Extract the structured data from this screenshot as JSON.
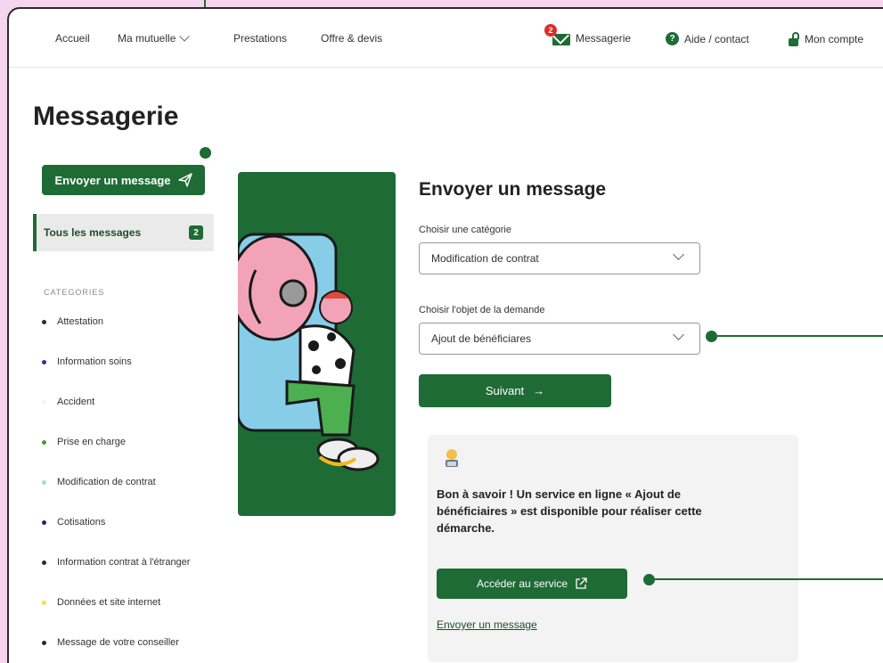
{
  "nav": {
    "accueil": "Accueil",
    "ma_mutuelle": "Ma mutuelle",
    "prestations": "Prestations",
    "offre_devis": "Offre & devis",
    "messagerie": "Messagerie",
    "messagerie_badge": "2",
    "aide": "Aide / contact",
    "mon_compte": "Mon compte"
  },
  "page_title": "Messagerie",
  "sidebar": {
    "send_button": "Envoyer un message",
    "all_messages": "Tous les messages",
    "all_messages_count": "2",
    "categories_title": "CATEGORIES",
    "categories": [
      {
        "label": "Attestation",
        "color": "#2b2b2b"
      },
      {
        "label": "Information soins",
        "color": "#2b3a8c"
      },
      {
        "label": "Accident",
        "color": "#f3f3f3"
      },
      {
        "label": "Prise en charge",
        "color": "#4c9a2a"
      },
      {
        "label": "Modification de contrat",
        "color": "#a7d8e0"
      },
      {
        "label": "Cotisations",
        "color": "#1f2a66"
      },
      {
        "label": "Information contrat à l'étranger",
        "color": "#2b2b2b"
      },
      {
        "label": "Données et site internet",
        "color": "#f2e14c"
      },
      {
        "label": "Message de votre conseiller",
        "color": "#2b2b2b"
      }
    ]
  },
  "form": {
    "title": "Envoyer un message",
    "category_label": "Choisir une catégorie",
    "category_value": "Modification de contrat",
    "object_label": "Choisir l'objet de la demande",
    "object_value": "Ajout de bénéficiares",
    "next_button": "Suivant"
  },
  "info": {
    "text": "Bon à savoir ! Un service en ligne « Ajout de bénéficiaires » est disponible pour réaliser cette démarche.",
    "access_button": "Accéder au service",
    "send_link": "Envoyer un message"
  },
  "colors": {
    "accent": "#1e6b35",
    "background": "#f6d5ee"
  }
}
